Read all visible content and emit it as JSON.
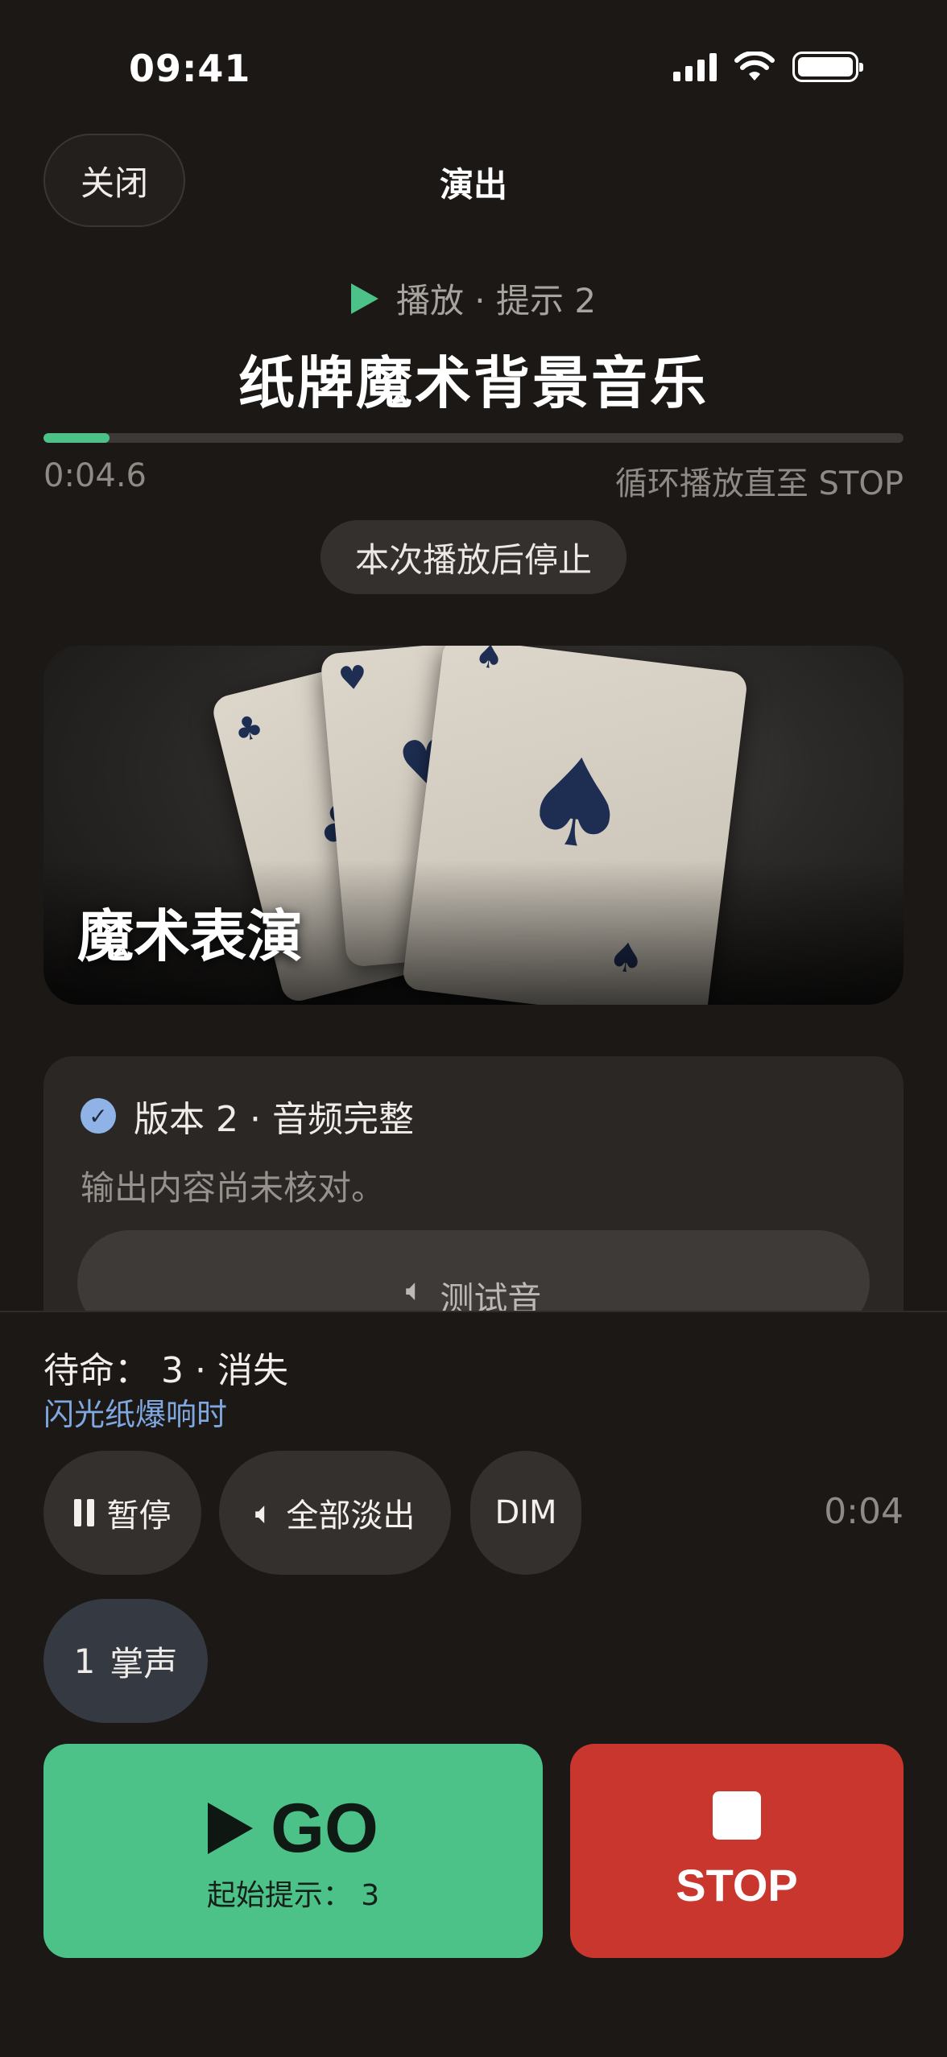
{
  "status_bar": {
    "time": "09:41"
  },
  "nav": {
    "close_label": "关闭",
    "title": "演出"
  },
  "now_playing": {
    "status": "播放 · 提示 2",
    "title": "纸牌魔术背景音乐",
    "progress": 0.077,
    "elapsed": "0:04.6",
    "loop_note": "循环播放直至 STOP",
    "stop_after_label": "本次播放后停止"
  },
  "artwork": {
    "label": "魔术表演"
  },
  "version": {
    "heading": "版本 2 · 音频完整",
    "note": "输出内容尚未核对。",
    "test_label": "测试音"
  },
  "panel": {
    "standby": "待命： 3 · 消失",
    "standby_sub": "闪光纸爆响时",
    "pause_label": "暂停",
    "fade_label": "全部淡出",
    "dim_label": "DIM",
    "time": "0:04",
    "cue_number": "1",
    "cue_label": "掌声",
    "go_label": "GO",
    "go_sub": "起始提示： 3",
    "stop_label": "STOP"
  },
  "colors": {
    "accent_green": "#4cc288",
    "stop_red": "#c8362e",
    "link_blue": "#7fa7e0"
  }
}
